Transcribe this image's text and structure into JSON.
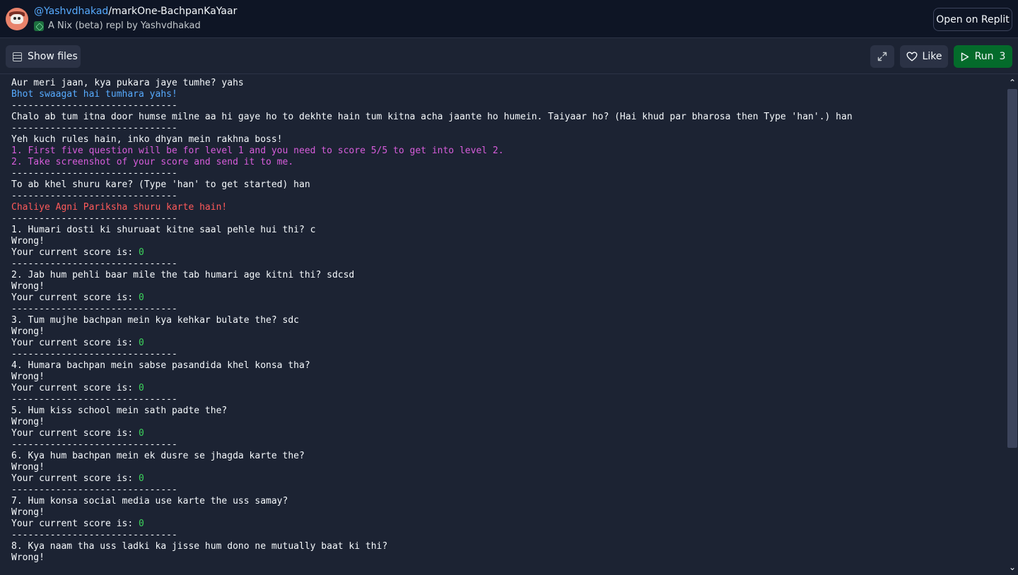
{
  "header": {
    "user": "@Yashvdhakad",
    "separator": "/",
    "repl_name": "markOne-BachpanKaYaar",
    "subtitle": "A Nix (beta) repl by Yashvdhakad",
    "open_button": "Open on Replit"
  },
  "toolbar": {
    "show_files": "Show files",
    "like": "Like",
    "run": "Run",
    "run_count": "3"
  },
  "colors": {
    "accent_blue": "#57abff",
    "magenta": "#d75ddb",
    "red": "#ff5a5a",
    "green": "#3cd45c",
    "run_green": "#046b2b"
  },
  "console": {
    "lines": [
      {
        "text": "Aur meri jaan, kya pukara jaye tumhe? yahs",
        "color": "white"
      },
      {
        "text": "Bhot swaagat hai tumhara yahs!",
        "color": "blue"
      },
      {
        "text": "------------------------------",
        "color": "white"
      },
      {
        "text": "Chalo ab tum itna door humse milne aa hi gaye ho to dekhte hain tum kitna acha jaante ho humein. Taiyaar ho? (Hai khud par bharosa then Type 'han'.) han",
        "color": "white"
      },
      {
        "text": "------------------------------",
        "color": "white"
      },
      {
        "text": "Yeh kuch rules hain, inko dhyan mein rakhna boss!",
        "color": "white"
      },
      {
        "text": "1. First five question will be for level 1 and you need to score 5/5 to get into level 2.",
        "color": "magenta"
      },
      {
        "text": "2. Take screenshot of your score and send it to me.",
        "color": "magenta"
      },
      {
        "text": "------------------------------",
        "color": "white"
      },
      {
        "text": "To ab khel shuru kare? (Type 'han' to get started) han",
        "color": "white"
      },
      {
        "text": "------------------------------",
        "color": "white"
      },
      {
        "text": "Chaliye Agni Pariksha shuru karte hain!",
        "color": "red"
      },
      {
        "text": "------------------------------",
        "color": "white"
      },
      {
        "text": "1. Humari dosti ki shuruaat kitne saal pehle hui thi? c",
        "color": "white"
      },
      {
        "text": "Wrong!",
        "color": "white"
      },
      {
        "text": "Your current score is: ",
        "color": "white",
        "score": "0"
      },
      {
        "text": "------------------------------",
        "color": "white"
      },
      {
        "text": "2. Jab hum pehli baar mile the tab humari age kitni thi? sdcsd",
        "color": "white"
      },
      {
        "text": "Wrong!",
        "color": "white"
      },
      {
        "text": "Your current score is: ",
        "color": "white",
        "score": "0"
      },
      {
        "text": "------------------------------",
        "color": "white"
      },
      {
        "text": "3. Tum mujhe bachpan mein kya kehkar bulate the? sdc",
        "color": "white"
      },
      {
        "text": "Wrong!",
        "color": "white"
      },
      {
        "text": "Your current score is: ",
        "color": "white",
        "score": "0"
      },
      {
        "text": "------------------------------",
        "color": "white"
      },
      {
        "text": "4. Humara bachpan mein sabse pasandida khel konsa tha?",
        "color": "white"
      },
      {
        "text": "Wrong!",
        "color": "white"
      },
      {
        "text": "Your current score is: ",
        "color": "white",
        "score": "0"
      },
      {
        "text": "------------------------------",
        "color": "white"
      },
      {
        "text": "5. Hum kiss school mein sath padte the?",
        "color": "white"
      },
      {
        "text": "Wrong!",
        "color": "white"
      },
      {
        "text": "Your current score is: ",
        "color": "white",
        "score": "0"
      },
      {
        "text": "------------------------------",
        "color": "white"
      },
      {
        "text": "6. Kya hum bachpan mein ek dusre se jhagda karte the?",
        "color": "white"
      },
      {
        "text": "Wrong!",
        "color": "white"
      },
      {
        "text": "Your current score is: ",
        "color": "white",
        "score": "0"
      },
      {
        "text": "------------------------------",
        "color": "white"
      },
      {
        "text": "7. Hum konsa social media use karte the uss samay?",
        "color": "white"
      },
      {
        "text": "Wrong!",
        "color": "white"
      },
      {
        "text": "Your current score is: ",
        "color": "white",
        "score": "0"
      },
      {
        "text": "------------------------------",
        "color": "white"
      },
      {
        "text": "8. Kya naam tha uss ladki ka jisse hum dono ne mutually baat ki thi?",
        "color": "white"
      },
      {
        "text": "Wrong!",
        "color": "white"
      }
    ]
  }
}
